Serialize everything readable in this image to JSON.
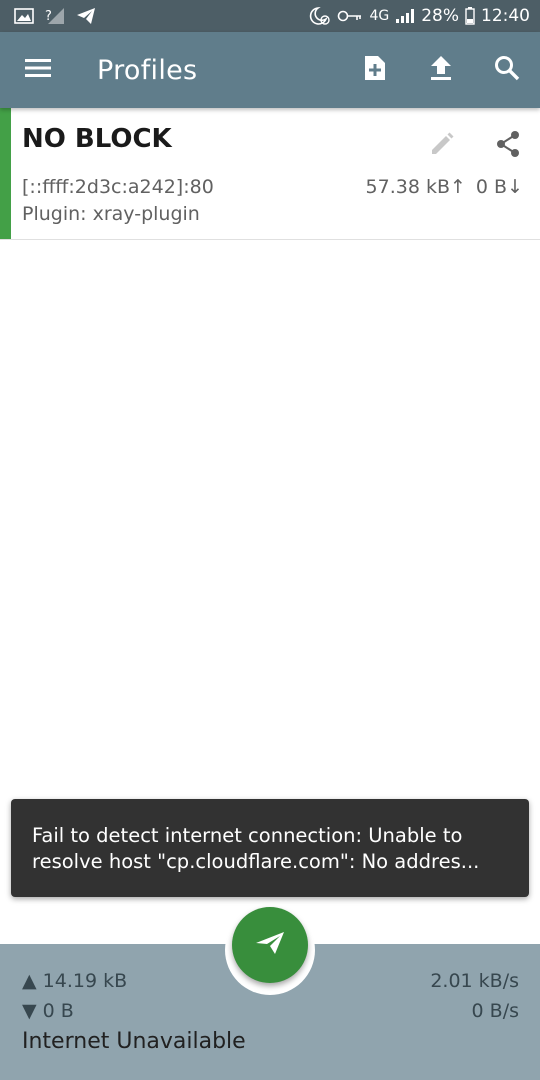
{
  "status_bar": {
    "battery": "28%",
    "time": "12:40",
    "network": "4G",
    "icons": [
      "image-icon",
      "signal-unknown-icon",
      "telegram-icon",
      "alarm-icon",
      "vpn-key-icon",
      "signal-icon",
      "battery-icon"
    ]
  },
  "app_bar": {
    "title": "Profiles",
    "actions": [
      "add-file-icon",
      "upload-icon",
      "search-icon"
    ]
  },
  "profile": {
    "name": "NO BLOCK",
    "address": "[::ffff:2d3c:a242]:80",
    "plugin": "Plugin: xray-plugin",
    "tx": "57.38 kB↑",
    "rx": "0 B↓",
    "accent_color": "#43a047"
  },
  "snackbar": {
    "line1": "Fail to detect internet connection: Unable to",
    "line2": "resolve host \"cp.cloudflare.com\": No addres..."
  },
  "bottom": {
    "tx_total": "▲ 14.19 kB",
    "rx_total": "▼ 0 B",
    "tx_rate": "2.01 kB/s",
    "rx_rate": "0 B/s",
    "status": "Internet Unavailable"
  },
  "colors": {
    "status_bar": "#4d5e66",
    "app_bar": "#607d8b",
    "bottom_bar": "#90a4ae",
    "fab": "#388e3c",
    "snackbar": "#323232"
  }
}
